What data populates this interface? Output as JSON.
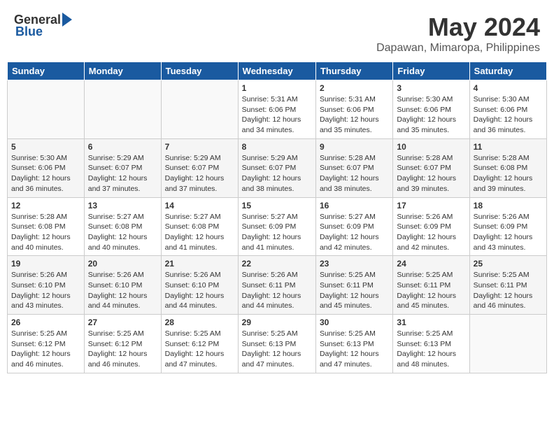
{
  "header": {
    "logo_general": "General",
    "logo_blue": "Blue",
    "title": "May 2024",
    "location": "Dapawan, Mimaropa, Philippines"
  },
  "weekdays": [
    "Sunday",
    "Monday",
    "Tuesday",
    "Wednesday",
    "Thursday",
    "Friday",
    "Saturday"
  ],
  "weeks": [
    [
      {
        "day": "",
        "info": ""
      },
      {
        "day": "",
        "info": ""
      },
      {
        "day": "",
        "info": ""
      },
      {
        "day": "1",
        "info": "Sunrise: 5:31 AM\nSunset: 6:06 PM\nDaylight: 12 hours and 34 minutes."
      },
      {
        "day": "2",
        "info": "Sunrise: 5:31 AM\nSunset: 6:06 PM\nDaylight: 12 hours and 35 minutes."
      },
      {
        "day": "3",
        "info": "Sunrise: 5:30 AM\nSunset: 6:06 PM\nDaylight: 12 hours and 35 minutes."
      },
      {
        "day": "4",
        "info": "Sunrise: 5:30 AM\nSunset: 6:06 PM\nDaylight: 12 hours and 36 minutes."
      }
    ],
    [
      {
        "day": "5",
        "info": "Sunrise: 5:30 AM\nSunset: 6:06 PM\nDaylight: 12 hours and 36 minutes."
      },
      {
        "day": "6",
        "info": "Sunrise: 5:29 AM\nSunset: 6:07 PM\nDaylight: 12 hours and 37 minutes."
      },
      {
        "day": "7",
        "info": "Sunrise: 5:29 AM\nSunset: 6:07 PM\nDaylight: 12 hours and 37 minutes."
      },
      {
        "day": "8",
        "info": "Sunrise: 5:29 AM\nSunset: 6:07 PM\nDaylight: 12 hours and 38 minutes."
      },
      {
        "day": "9",
        "info": "Sunrise: 5:28 AM\nSunset: 6:07 PM\nDaylight: 12 hours and 38 minutes."
      },
      {
        "day": "10",
        "info": "Sunrise: 5:28 AM\nSunset: 6:07 PM\nDaylight: 12 hours and 39 minutes."
      },
      {
        "day": "11",
        "info": "Sunrise: 5:28 AM\nSunset: 6:08 PM\nDaylight: 12 hours and 39 minutes."
      }
    ],
    [
      {
        "day": "12",
        "info": "Sunrise: 5:28 AM\nSunset: 6:08 PM\nDaylight: 12 hours and 40 minutes."
      },
      {
        "day": "13",
        "info": "Sunrise: 5:27 AM\nSunset: 6:08 PM\nDaylight: 12 hours and 40 minutes."
      },
      {
        "day": "14",
        "info": "Sunrise: 5:27 AM\nSunset: 6:08 PM\nDaylight: 12 hours and 41 minutes."
      },
      {
        "day": "15",
        "info": "Sunrise: 5:27 AM\nSunset: 6:09 PM\nDaylight: 12 hours and 41 minutes."
      },
      {
        "day": "16",
        "info": "Sunrise: 5:27 AM\nSunset: 6:09 PM\nDaylight: 12 hours and 42 minutes."
      },
      {
        "day": "17",
        "info": "Sunrise: 5:26 AM\nSunset: 6:09 PM\nDaylight: 12 hours and 42 minutes."
      },
      {
        "day": "18",
        "info": "Sunrise: 5:26 AM\nSunset: 6:09 PM\nDaylight: 12 hours and 43 minutes."
      }
    ],
    [
      {
        "day": "19",
        "info": "Sunrise: 5:26 AM\nSunset: 6:10 PM\nDaylight: 12 hours and 43 minutes."
      },
      {
        "day": "20",
        "info": "Sunrise: 5:26 AM\nSunset: 6:10 PM\nDaylight: 12 hours and 44 minutes."
      },
      {
        "day": "21",
        "info": "Sunrise: 5:26 AM\nSunset: 6:10 PM\nDaylight: 12 hours and 44 minutes."
      },
      {
        "day": "22",
        "info": "Sunrise: 5:26 AM\nSunset: 6:11 PM\nDaylight: 12 hours and 44 minutes."
      },
      {
        "day": "23",
        "info": "Sunrise: 5:25 AM\nSunset: 6:11 PM\nDaylight: 12 hours and 45 minutes."
      },
      {
        "day": "24",
        "info": "Sunrise: 5:25 AM\nSunset: 6:11 PM\nDaylight: 12 hours and 45 minutes."
      },
      {
        "day": "25",
        "info": "Sunrise: 5:25 AM\nSunset: 6:11 PM\nDaylight: 12 hours and 46 minutes."
      }
    ],
    [
      {
        "day": "26",
        "info": "Sunrise: 5:25 AM\nSunset: 6:12 PM\nDaylight: 12 hours and 46 minutes."
      },
      {
        "day": "27",
        "info": "Sunrise: 5:25 AM\nSunset: 6:12 PM\nDaylight: 12 hours and 46 minutes."
      },
      {
        "day": "28",
        "info": "Sunrise: 5:25 AM\nSunset: 6:12 PM\nDaylight: 12 hours and 47 minutes."
      },
      {
        "day": "29",
        "info": "Sunrise: 5:25 AM\nSunset: 6:13 PM\nDaylight: 12 hours and 47 minutes."
      },
      {
        "day": "30",
        "info": "Sunrise: 5:25 AM\nSunset: 6:13 PM\nDaylight: 12 hours and 47 minutes."
      },
      {
        "day": "31",
        "info": "Sunrise: 5:25 AM\nSunset: 6:13 PM\nDaylight: 12 hours and 48 minutes."
      },
      {
        "day": "",
        "info": ""
      }
    ]
  ]
}
